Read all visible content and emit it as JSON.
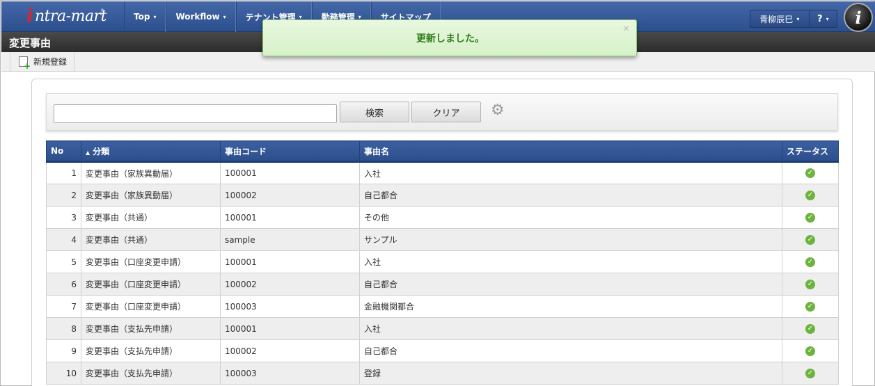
{
  "nav": {
    "logo": "intra-mart",
    "logo_initial": "i",
    "logo_rest": "ntra-mart",
    "logo_reg": "®",
    "items": [
      {
        "label": "Top"
      },
      {
        "label": "Workflow"
      },
      {
        "label": "テナント管理"
      },
      {
        "label": "勤務管理"
      },
      {
        "label": "サイトマップ"
      }
    ],
    "user_name": "青柳辰巳",
    "help_label": "?",
    "caret": "▾",
    "im_logo": "i"
  },
  "page": {
    "title": "変更事由"
  },
  "toolbar": {
    "new_label": "新規登録"
  },
  "search": {
    "value": "",
    "placeholder": "",
    "search_label": "検索",
    "clear_label": "クリア",
    "gear": "⚙"
  },
  "table": {
    "headers": {
      "no": "No",
      "category": "分類",
      "sort_indicator": "▲",
      "code": "事由コード",
      "name": "事由名",
      "status": "ステータス"
    },
    "status_icon": "✓",
    "rows": [
      {
        "no": "1",
        "category": "変更事由（家族異動届）",
        "code": "100001",
        "name": "入社"
      },
      {
        "no": "2",
        "category": "変更事由（家族異動届）",
        "code": "100002",
        "name": "自己都合"
      },
      {
        "no": "3",
        "category": "変更事由（共通）",
        "code": "100001",
        "name": "その他"
      },
      {
        "no": "4",
        "category": "変更事由（共通）",
        "code": "sample",
        "name": "サンプル"
      },
      {
        "no": "5",
        "category": "変更事由（口座変更申請）",
        "code": "100001",
        "name": "入社"
      },
      {
        "no": "6",
        "category": "変更事由（口座変更申請）",
        "code": "100002",
        "name": "自己都合"
      },
      {
        "no": "7",
        "category": "変更事由（口座変更申請）",
        "code": "100003",
        "name": "金融機関都合"
      },
      {
        "no": "8",
        "category": "変更事由（支払先申請）",
        "code": "100001",
        "name": "入社"
      },
      {
        "no": "9",
        "category": "変更事由（支払先申請）",
        "code": "100002",
        "name": "自己都合"
      },
      {
        "no": "10",
        "category": "変更事由（支払先申請）",
        "code": "100003",
        "name": "登録"
      }
    ]
  },
  "toast": {
    "message": "更新しました。",
    "close": "×"
  },
  "colors": {
    "nav_bg": "#2c4f8d",
    "title_bg": "#2b2b2b",
    "header_bg": "#2d4e8b",
    "status_ok": "#6cb33f",
    "toast_text": "#2f7d1b"
  }
}
